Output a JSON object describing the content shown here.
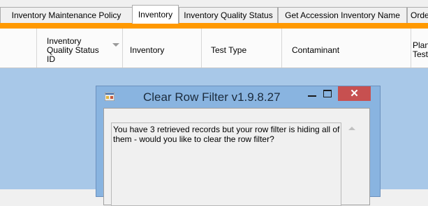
{
  "tabs": [
    {
      "label": "Inventory Maintenance Policy"
    },
    {
      "label": "Inventory",
      "active": true
    },
    {
      "label": "Inventory Quality Status"
    },
    {
      "label": "Get Accession Inventory Name"
    },
    {
      "label": "Orde"
    }
  ],
  "grid": {
    "columns": [
      {
        "label": "Inventory Quality Status ID",
        "lines": [
          "Inventory",
          "Quality Status",
          "ID"
        ]
      },
      {
        "label": "Inventory"
      },
      {
        "label": "Test Type"
      },
      {
        "label": "Contaminant"
      },
      {
        "label": "Plan Test",
        "lines": [
          "Plan",
          "Test"
        ]
      }
    ],
    "sort_icon": "sort-down-icon"
  },
  "dialog": {
    "title": "Clear Row Filter v1.9.8.27",
    "icon": "app-icon",
    "minimize_icon": "minimize-icon",
    "maximize_icon": "maximize-icon",
    "close_glyph": "✕",
    "message_line1": "You have 3 retrieved records but your row filter is hiding all of",
    "message_line2": "them - would you like to clear the row filter?"
  },
  "colors": {
    "accent_bar": "#ff9900",
    "grid_background": "#a8c8e8",
    "dialog_frame": "#89b4e0",
    "close_button": "#c75050"
  }
}
